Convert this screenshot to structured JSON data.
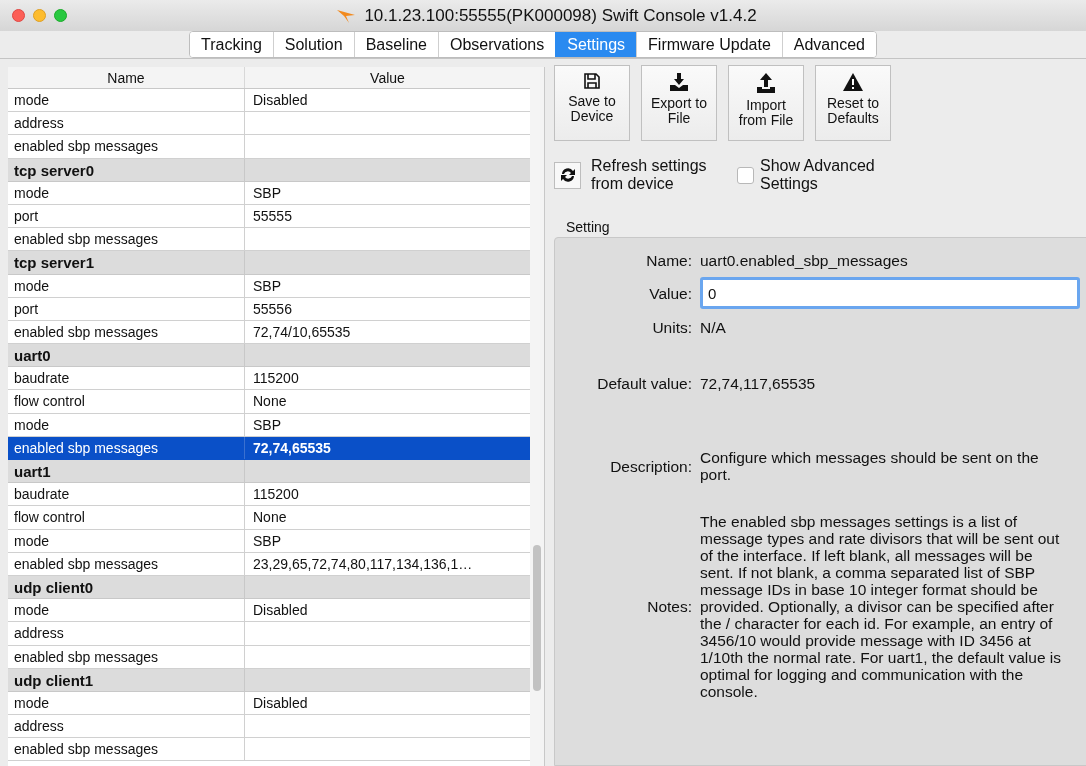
{
  "window": {
    "title": "10.1.23.100:55555(PK000098) Swift Console v1.4.2"
  },
  "tabs": [
    {
      "label": "Tracking",
      "selected": false
    },
    {
      "label": "Solution",
      "selected": false
    },
    {
      "label": "Baseline",
      "selected": false
    },
    {
      "label": "Observations",
      "selected": false
    },
    {
      "label": "Settings",
      "selected": true
    },
    {
      "label": "Firmware Update",
      "selected": false
    },
    {
      "label": "Advanced",
      "selected": false
    }
  ],
  "table": {
    "columns": [
      "Name",
      "Value"
    ],
    "rows": [
      {
        "kind": "setting",
        "name": "mode",
        "value": "Disabled",
        "selected": false
      },
      {
        "kind": "setting",
        "name": "address",
        "value": "",
        "selected": false
      },
      {
        "kind": "setting",
        "name": "enabled sbp messages",
        "value": "",
        "selected": false
      },
      {
        "kind": "group",
        "name": "tcp server0"
      },
      {
        "kind": "setting",
        "name": "mode",
        "value": "SBP",
        "selected": false
      },
      {
        "kind": "setting",
        "name": "port",
        "value": "55555",
        "selected": false
      },
      {
        "kind": "setting",
        "name": "enabled sbp messages",
        "value": "",
        "selected": false
      },
      {
        "kind": "group",
        "name": "tcp server1"
      },
      {
        "kind": "setting",
        "name": "mode",
        "value": "SBP",
        "selected": false
      },
      {
        "kind": "setting",
        "name": "port",
        "value": "55556",
        "selected": false
      },
      {
        "kind": "setting",
        "name": "enabled sbp messages",
        "value": "72,74/10,65535",
        "selected": false
      },
      {
        "kind": "group",
        "name": "uart0"
      },
      {
        "kind": "setting",
        "name": "baudrate",
        "value": "115200",
        "selected": false
      },
      {
        "kind": "setting",
        "name": "flow control",
        "value": "None",
        "selected": false
      },
      {
        "kind": "setting",
        "name": "mode",
        "value": "SBP",
        "selected": false
      },
      {
        "kind": "setting",
        "name": "enabled sbp messages",
        "value": "72,74,65535",
        "selected": true
      },
      {
        "kind": "group",
        "name": "uart1"
      },
      {
        "kind": "setting",
        "name": "baudrate",
        "value": "115200",
        "selected": false
      },
      {
        "kind": "setting",
        "name": "flow control",
        "value": "None",
        "selected": false
      },
      {
        "kind": "setting",
        "name": "mode",
        "value": "SBP",
        "selected": false
      },
      {
        "kind": "setting",
        "name": "enabled sbp messages",
        "value": "23,29,65,72,74,80,117,134,136,1…",
        "selected": false
      },
      {
        "kind": "group",
        "name": "udp client0"
      },
      {
        "kind": "setting",
        "name": "mode",
        "value": "Disabled",
        "selected": false
      },
      {
        "kind": "setting",
        "name": "address",
        "value": "",
        "selected": false
      },
      {
        "kind": "setting",
        "name": "enabled sbp messages",
        "value": "",
        "selected": false
      },
      {
        "kind": "group",
        "name": "udp client1"
      },
      {
        "kind": "setting",
        "name": "mode",
        "value": "Disabled",
        "selected": false
      },
      {
        "kind": "setting",
        "name": "address",
        "value": "",
        "selected": false
      },
      {
        "kind": "setting",
        "name": "enabled sbp messages",
        "value": "",
        "selected": false
      }
    ]
  },
  "toolbar": [
    {
      "kind": "save",
      "label": "Save to Device"
    },
    {
      "kind": "export",
      "label": "Export to File"
    },
    {
      "kind": "import",
      "label": "Import from File"
    },
    {
      "kind": "reset",
      "label": "Reset to Defaults"
    }
  ],
  "refresh_button": {
    "label": "Refresh settings from device"
  },
  "show_advanced": {
    "label": "Show Advanced Settings",
    "checked": false
  },
  "setting": {
    "title": "Setting",
    "fields": [
      {
        "kind": "text",
        "label": "Name:",
        "value": "uart0.enabled_sbp_messages"
      },
      {
        "kind": "input",
        "label": "Value:",
        "value": "0"
      },
      {
        "kind": "text",
        "label": "Units:",
        "value": "N/A"
      },
      {
        "kind": "text",
        "label": "Default value:",
        "value": "72,74,117,65535"
      },
      {
        "kind": "text",
        "label": "Description:",
        "value": "Configure which messages should be sent on the port."
      },
      {
        "kind": "text",
        "label": "Notes:",
        "value": "The enabled sbp messages settings is a list of message types and rate divisors that will be sent out of the interface. If left blank, all messages will be sent. If not blank, a comma separated list of SBP message IDs in base 10 integer format should be provided.  Optionally, a divisor can be specified after the / character for each id.  For example, an entry of 3456/10 would provide message with ID 3456 at 1/10th the normal rate.  For uart1, the default value is optimal for logging and communication with the console."
      }
    ]
  }
}
